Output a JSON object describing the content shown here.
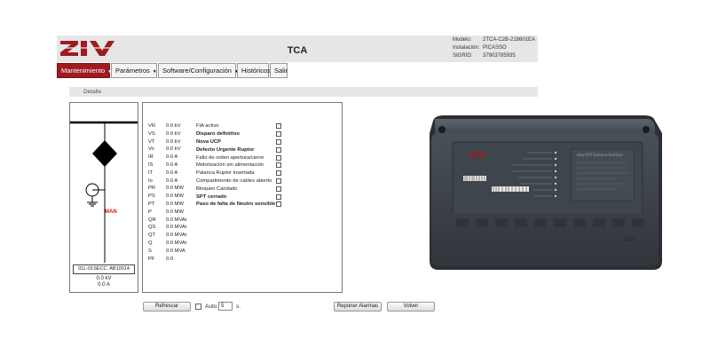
{
  "header": {
    "logo_text": "ZIV",
    "title": "TCA",
    "device_info": [
      {
        "label": "Modelo:",
        "value": "2TCA-C2B-218601EA"
      },
      {
        "label": "Instalación:",
        "value": "PICASSO"
      },
      {
        "label": "SIGRID:",
        "value": "37903785935"
      }
    ]
  },
  "menu": [
    {
      "label": "Mantenimiento",
      "caret": "▼"
    },
    {
      "label": "Parámetros",
      "caret": "▼"
    },
    {
      "label": "Software/Configuración",
      "caret": "▼"
    },
    {
      "label": "Históricos",
      "caret": ""
    },
    {
      "label": "Salir",
      "caret": ""
    }
  ],
  "detail_title": "Detalle",
  "schematic": {
    "mode_label": "MAN",
    "equipment_id": "01L-01SECC. AB10014",
    "voltage": "0.0 kV",
    "current": "0.0 A"
  },
  "measurements": [
    {
      "name": "VR",
      "value": "0.0 kV"
    },
    {
      "name": "VS",
      "value": "0.0 kV"
    },
    {
      "name": "VT",
      "value": "0.0 kV"
    },
    {
      "name": "Vo",
      "value": "0.0 kV"
    },
    {
      "name": "IR",
      "value": "0.0 A"
    },
    {
      "name": "IS",
      "value": "0.0 A"
    },
    {
      "name": "IT",
      "value": "0.0 A"
    },
    {
      "name": "Io",
      "value": "0.0 A"
    },
    {
      "name": "PR",
      "value": "0.0 MW"
    },
    {
      "name": "PS",
      "value": "0.0 MW"
    },
    {
      "name": "PT",
      "value": "0.0 MW"
    },
    {
      "name": "P",
      "value": "0.0 MW"
    },
    {
      "name": "QR",
      "value": "0.0 MVAr"
    },
    {
      "name": "QS",
      "value": "0.0 MVAr"
    },
    {
      "name": "QT",
      "value": "0.0 MVAr"
    },
    {
      "name": "Q",
      "value": "0.0 MVAr"
    },
    {
      "name": "S",
      "value": "0.0 MVA"
    },
    {
      "name": "PF",
      "value": "0.0"
    }
  ],
  "alarms": [
    {
      "label": "FIA activo",
      "bold": false
    },
    {
      "label": "Disparo definitivo",
      "bold": true
    },
    {
      "label": "Nova UCP",
      "bold": true
    },
    {
      "label": "Defecto Urgente Ruptor",
      "bold": true
    },
    {
      "label": "Fallo de orden apertura/cierre",
      "bold": false
    },
    {
      "label": "Motorización sin alimentación",
      "bold": false
    },
    {
      "label": "Palanca Ruptor insertada",
      "bold": false
    },
    {
      "label": "Compartimento de cables abierto",
      "bold": false
    },
    {
      "label": "Bloqueo Candado",
      "bold": false
    },
    {
      "label": "SPT cerrado",
      "bold": true
    },
    {
      "label": "Paso de falta de Neutro sensible",
      "bold": true
    }
  ],
  "controls": {
    "refresh_label": "Refrescar",
    "auto_label": "Auto",
    "auto_value": "5",
    "auto_unit": "s.",
    "reset_label": "Reponer Alarmas",
    "back_label": "Volver"
  },
  "device_photo": {
    "brand": "ZIV",
    "panel_label": "ekorUCP  Sistema-Ind-Ekor"
  },
  "colors": {
    "accent": "#9e1b1f",
    "schematic_alarm": "#d01818"
  }
}
